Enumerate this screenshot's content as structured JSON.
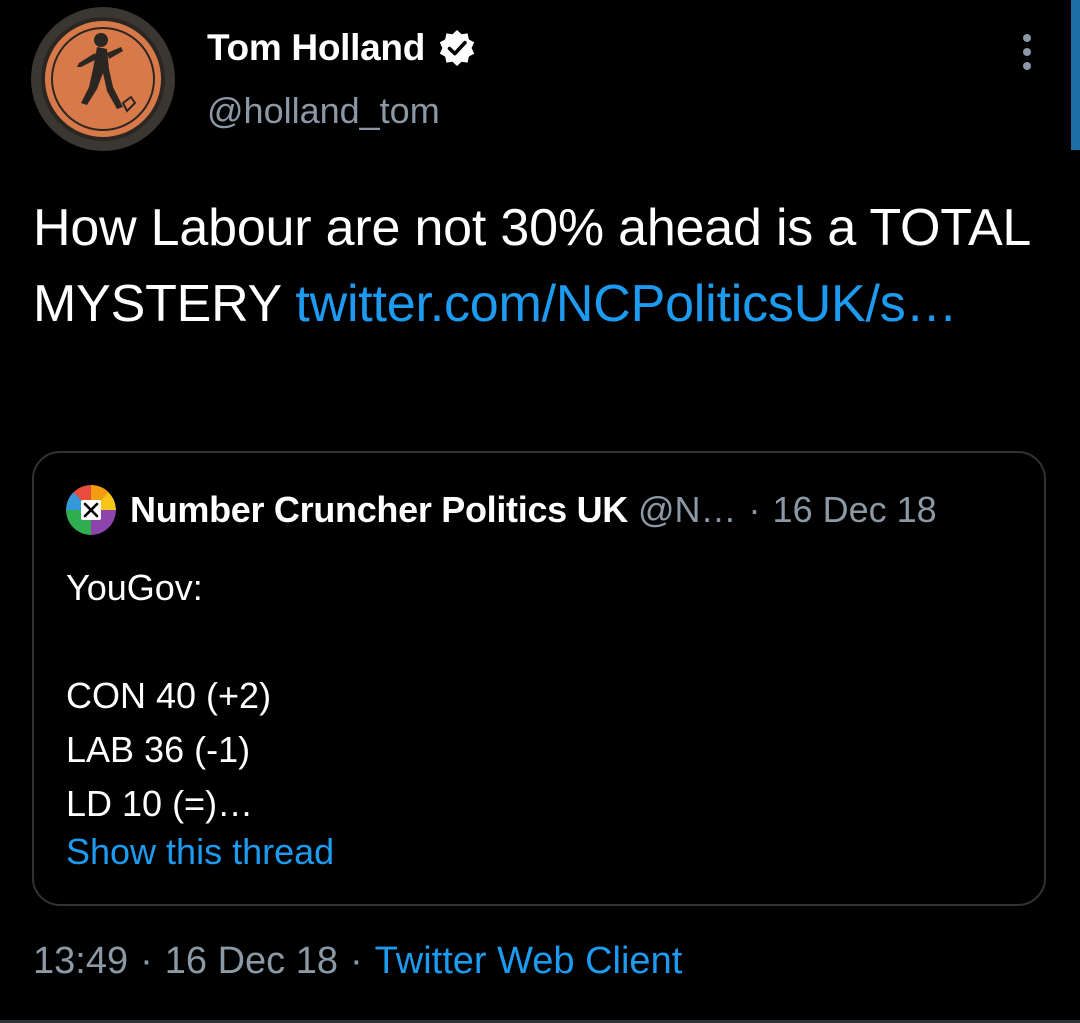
{
  "tweet": {
    "author": {
      "display_name": "Tom Holland",
      "handle": "@holland_tom",
      "verified": true,
      "avatar_icon": "greek-vase-figure-avatar"
    },
    "text_plain": "How Labour are not 30% ahead is a TOTAL MYSTERY ",
    "link_text": "twitter.com/NCPoliticsUK/s…",
    "more_icon": "more-vertical-icon"
  },
  "quoted_tweet": {
    "author_name": "Number Cruncher Politics UK",
    "author_handle": "@N…",
    "separator": "·",
    "date": "16 Dec 18",
    "avatar_icon": "colorful-cross-logo-avatar",
    "lines": [
      "YouGov:",
      "",
      "CON 40 (+2)",
      "LAB 36 (-1)",
      "LD 10 (=)…"
    ],
    "show_thread_label": "Show this thread"
  },
  "meta": {
    "time": "13:49",
    "separator": "·",
    "date": "16 Dec 18",
    "source": "Twitter Web Client"
  },
  "colors": {
    "background": "#000000",
    "text_primary": "#ffffff",
    "text_secondary": "#8b98a5",
    "link": "#1d9bf0",
    "border": "#2f3336"
  }
}
